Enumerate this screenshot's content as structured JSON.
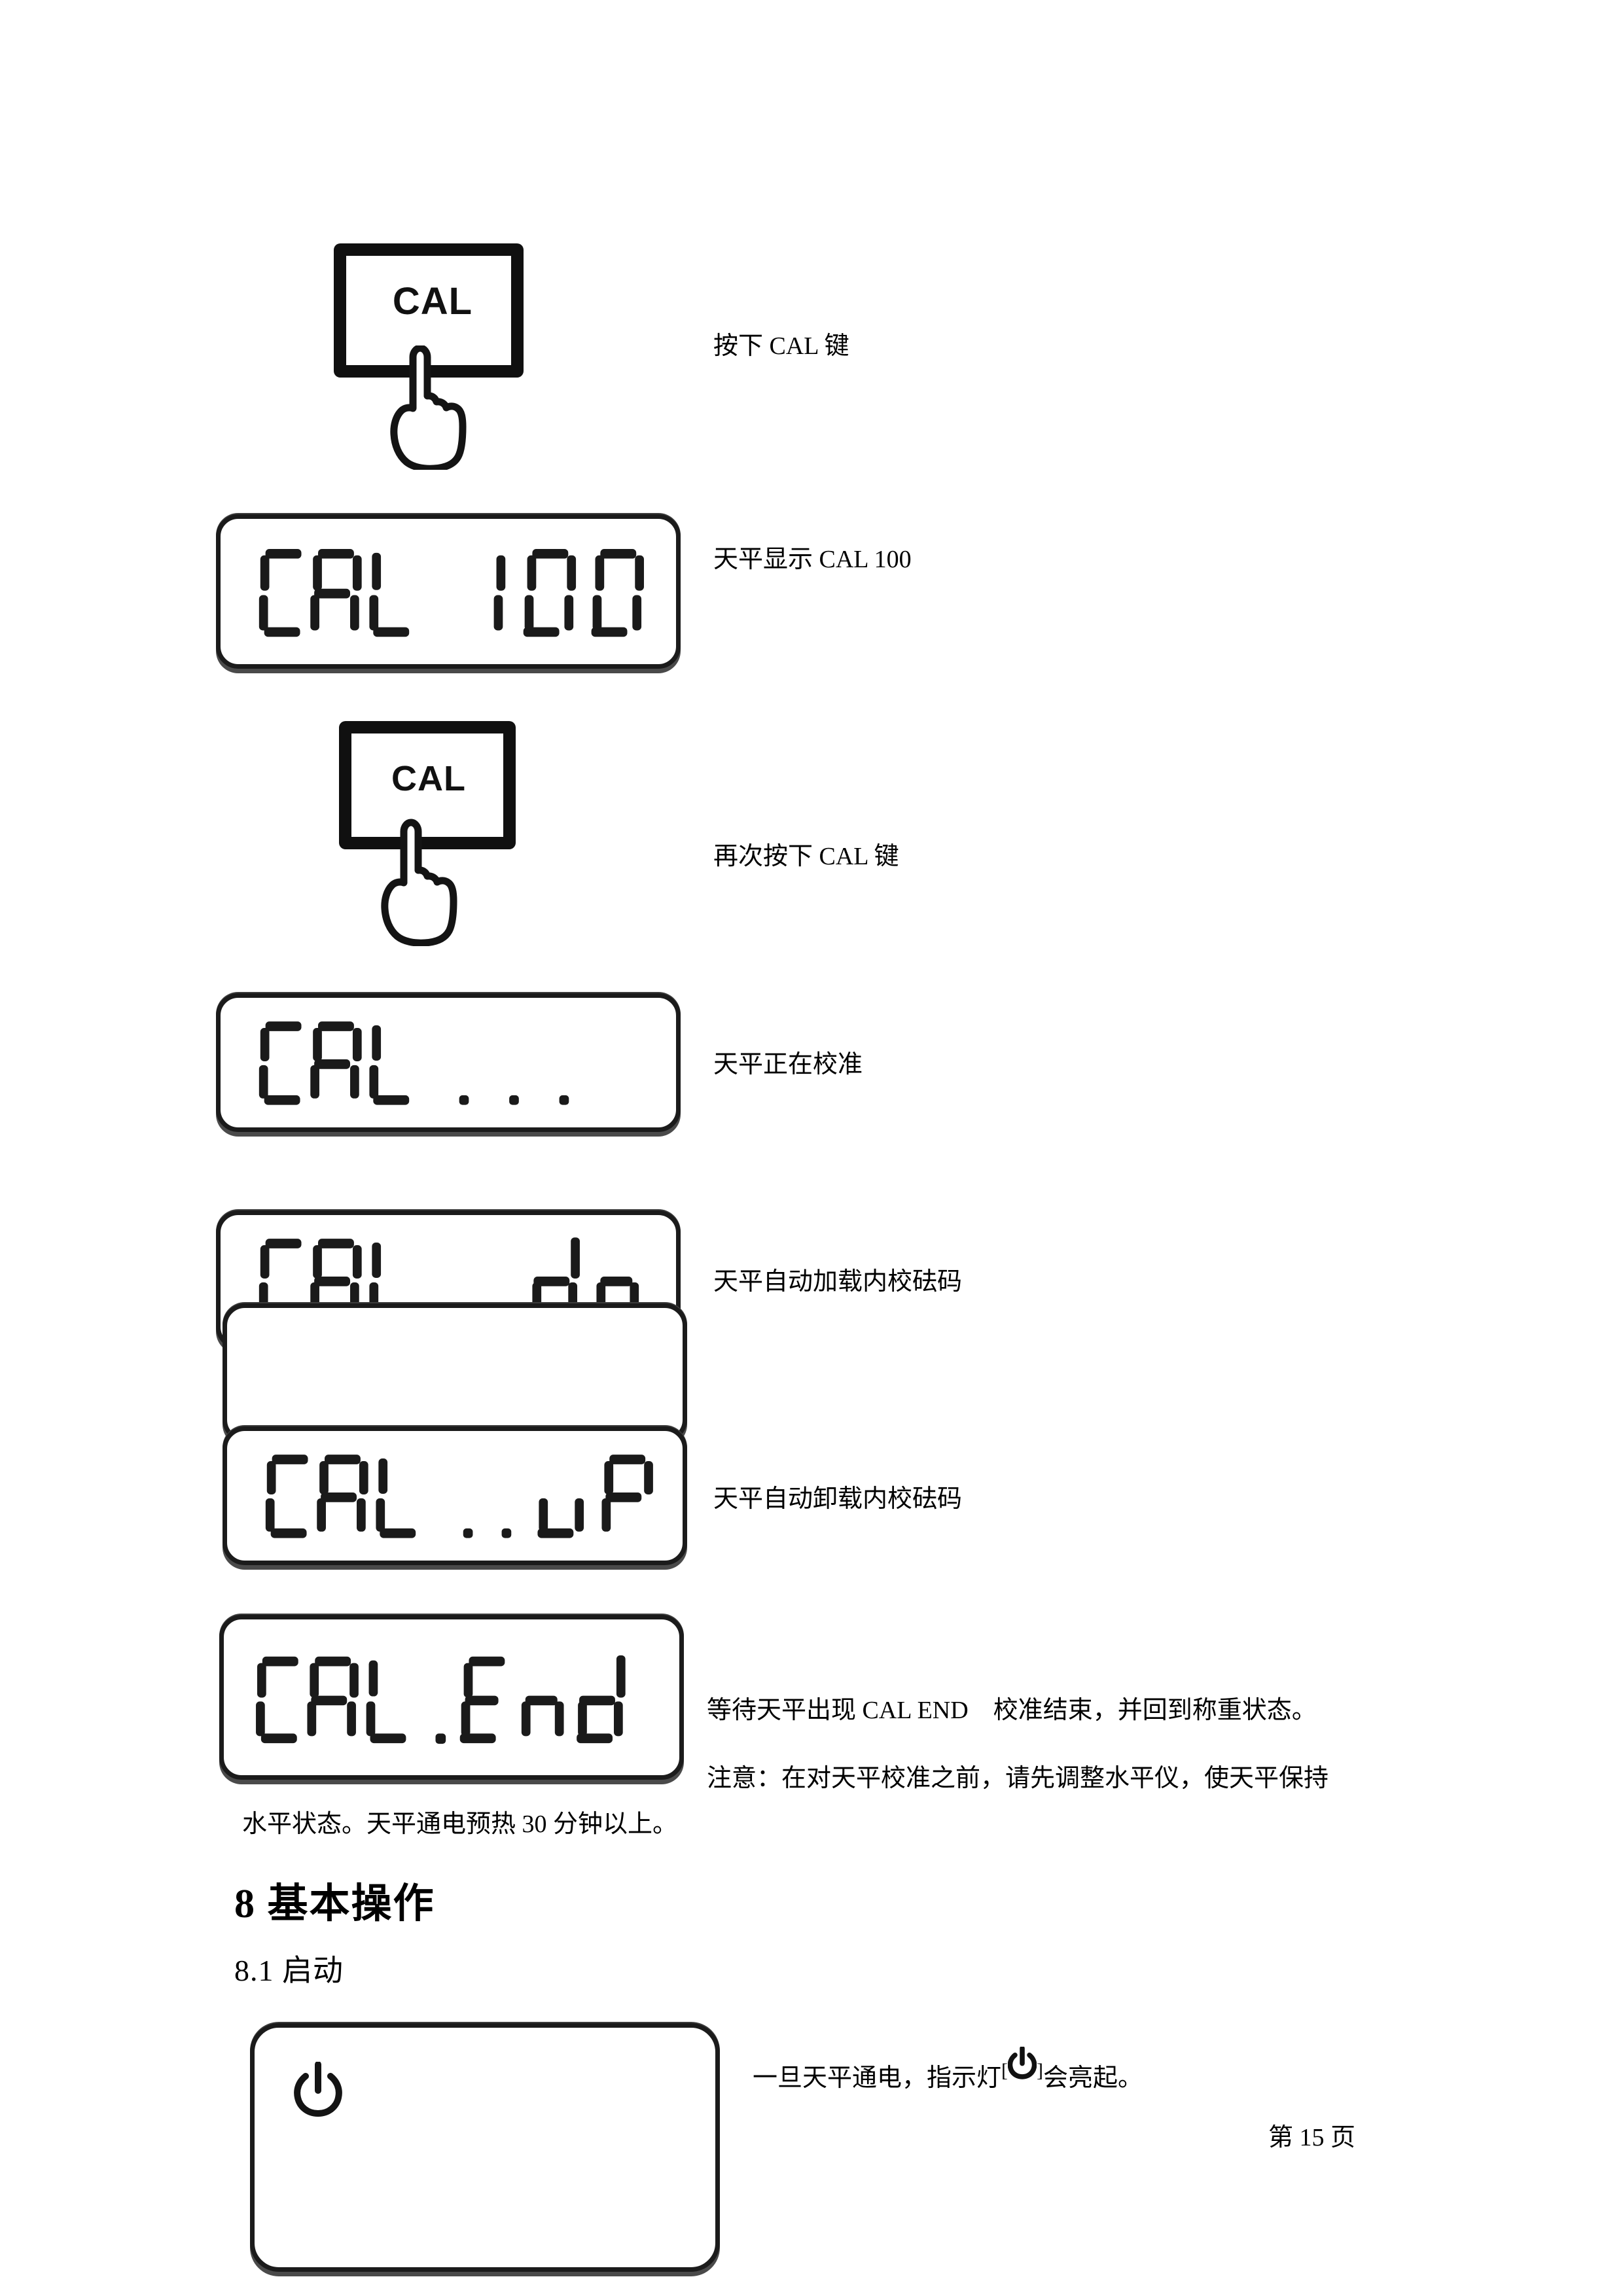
{
  "document": {
    "page_number_label": "第 15 页",
    "section_heading": "8 基本操作",
    "subsection_heading": "8.1 启动"
  },
  "steps": [
    {
      "id": "press-cal",
      "visual": "cal-key",
      "key_label": "CAL",
      "caption": "按下 CAL 键"
    },
    {
      "id": "display-cal-100",
      "visual": "lcd",
      "display_text": "CAL 100",
      "caption": "天平显示 CAL 100"
    },
    {
      "id": "press-cal-again",
      "visual": "cal-key",
      "key_label": "CAL",
      "caption": "再次按下 CAL 键"
    },
    {
      "id": "display-cal-dots",
      "visual": "lcd",
      "display_text": "CAL ...",
      "caption": "天平正在校准"
    },
    {
      "id": "display-cal-dn",
      "visual": "lcd",
      "display_text": "CAL ..dn",
      "caption": "天平自动加载内校砝码"
    },
    {
      "id": "display-cal-up",
      "visual": "lcd",
      "display_text": "CAL ..uP",
      "caption": "天平自动卸载内校砝码"
    },
    {
      "id": "display-cal-end",
      "visual": "lcd",
      "display_text": "CAL .End",
      "caption": "等待天平出现 CAL END　校准结束，并回到称重状态。"
    }
  ],
  "note": {
    "line1": "注意：在对天平校准之前，请先调整水平仪，使天平保持",
    "line2": "水平状态。天平通电预热 30 分钟以上。"
  },
  "startup": {
    "indicator_symbol": "⏻",
    "caption_before": "一旦天平通电，指示灯",
    "caption_bracket_open": "[",
    "caption_bracket_close": "]",
    "caption_after": "会亮起。"
  },
  "colors": {
    "ink": "#000000",
    "key_border": "#101010",
    "lcd_border": "#1b1b1b",
    "lcd_shadow": "#4a4a4a",
    "paper": "#ffffff"
  }
}
